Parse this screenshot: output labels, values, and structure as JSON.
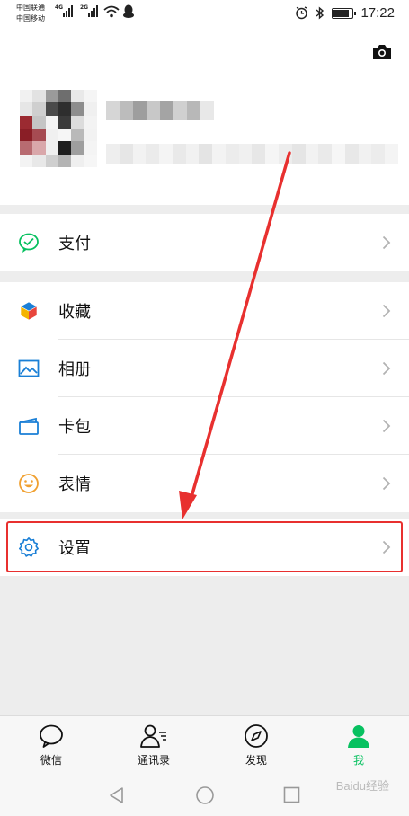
{
  "status_bar": {
    "carrier_1": "中国联通",
    "carrier_2": "中国移动",
    "network_1": "4G",
    "network_2": "2G",
    "time": "17:22",
    "icons": [
      "signal-icon",
      "wifi-icon",
      "qq-icon",
      "alarm-icon",
      "bluetooth-icon",
      "battery-icon"
    ],
    "battery_level": 0.85
  },
  "profile": {
    "camera_icon": "camera-icon",
    "avatar_colors": [
      "#f1f1f1",
      "#e2e2e2",
      "#9a9a9a",
      "#6e6e6e",
      "#e9e9e9",
      "#f5f5f5",
      "#e6e6e6",
      "#cfcfcf",
      "#4a4a4a",
      "#2e2e2e",
      "#8d8d8d",
      "#f0f0f0",
      "#9b2a31",
      "#c5c5c5",
      "#f4f4f4",
      "#3b3b3b",
      "#dcdcdc",
      "#f3f3f3",
      "#8a1e26",
      "#a64b52",
      "#f0f0f0",
      "#f6f6f6",
      "#b9b9b9",
      "#f2f2f2",
      "#b86b71",
      "#d9a7aa",
      "#efefef",
      "#1f1f1f",
      "#9e9e9e",
      "#f4f4f4",
      "#f3f3f3",
      "#e8e8e8",
      "#cfcfcf",
      "#b4b4b4",
      "#efefef",
      "#f6f6f6"
    ],
    "nickname_colors": [
      "#d6d6d6",
      "#bcbcbc",
      "#9e9e9e",
      "#c8c8c8",
      "#a4a4a4",
      "#d0d0d0",
      "#b8b8b8",
      "#e8e8e8"
    ],
    "wxid_colors": [
      "#eeeeee",
      "#e6e6e6",
      "#f2f2f2",
      "#ebebeb",
      "#f4f4f4",
      "#e9e9e9",
      "#f1f1f1",
      "#e4e4e4",
      "#f3f3f3",
      "#ececec",
      "#f0f0f0",
      "#e7e7e7",
      "#f5f5f5",
      "#ededed",
      "#e5e5e5",
      "#f2f2f2",
      "#eaeaea",
      "#f6f6f6",
      "#e8e8e8",
      "#f1f1f1",
      "#ececec",
      "#f4f4f4"
    ]
  },
  "menu": {
    "pay": {
      "label": "支付",
      "icon": "wechat-pay-icon"
    },
    "favorites": {
      "label": "收藏",
      "icon": "favorites-cube-icon"
    },
    "album": {
      "label": "相册",
      "icon": "album-image-icon"
    },
    "cards": {
      "label": "卡包",
      "icon": "card-wallet-icon"
    },
    "stickers": {
      "label": "表情",
      "icon": "sticker-smiley-icon"
    },
    "settings": {
      "label": "设置",
      "icon": "gear-icon"
    },
    "chevron_icon": "chevron-right-icon"
  },
  "annotation": {
    "highlight_color": "#e8302f"
  },
  "tabs": [
    {
      "label": "微信",
      "icon": "chat-bubble-icon",
      "active": false
    },
    {
      "label": "通讯录",
      "icon": "contacts-icon",
      "active": false
    },
    {
      "label": "发现",
      "icon": "compass-icon",
      "active": false
    },
    {
      "label": "我",
      "icon": "me-person-icon",
      "active": true
    }
  ],
  "nav_bar": {
    "icons": [
      "back-triangle-icon",
      "home-circle-icon",
      "recents-square-icon"
    ],
    "watermark": "Baidu经验"
  },
  "colors": {
    "accent_green": "#07c160",
    "icon_blue": "#1a7fd6",
    "icon_orange": "#f0a030"
  }
}
